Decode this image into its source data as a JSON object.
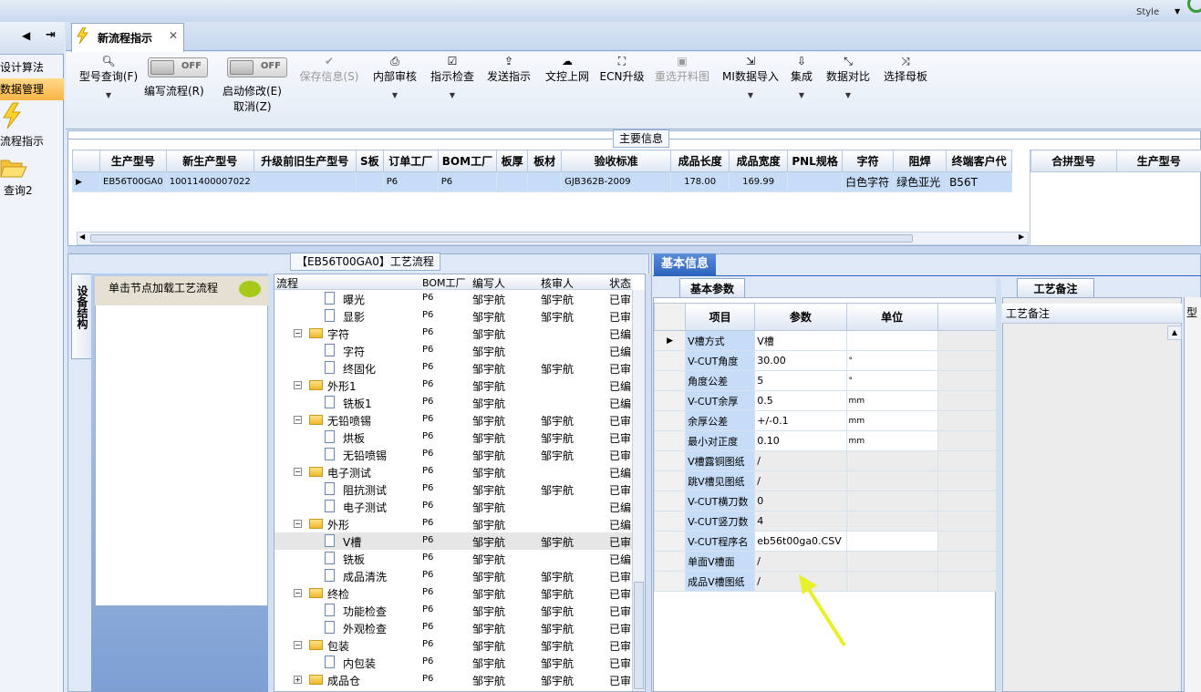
{
  "titlebar": {
    "style_label": "Style"
  },
  "leftnav": {
    "items": [
      "设计算法",
      "数据管理",
      "流程指示",
      "查询2"
    ],
    "selected": 1
  },
  "tab": {
    "label": "新流程指示"
  },
  "toolbar": {
    "model_query": "型号查询(F)",
    "edit_flow": "编写流程(R)",
    "toggle_off": "OFF",
    "start_modify": "启动修改(E)",
    "cancel": "取消(Z)",
    "save_info": "保存信息(S)",
    "internal_review": "内部审核",
    "check_indication": "指示检查",
    "send_indication": "发送指示",
    "doc_upload": "文控上网",
    "ecn_upgrade": "ECN升级",
    "reselect_drawing": "重选开料图",
    "mi_import": "MI数据导入",
    "integrate": "集成",
    "data_compare": "数据对比",
    "select_template": "选择母板"
  },
  "main": {
    "title": "主要信息",
    "columns": [
      "生产型号",
      "新生产型号",
      "升级前旧生产型号",
      "S板",
      "订单工厂",
      "BOM工厂",
      "板厚",
      "板材",
      "验收标准",
      "成品长度",
      "成品宽度",
      "PNL规格",
      "字符",
      "阻焊",
      "终端客户代"
    ],
    "row": [
      "EB56T00GA0",
      "10011400007022",
      "",
      "",
      "P6",
      "P6",
      "",
      "",
      "GJB362B-2009",
      "178.00",
      "169.99",
      "",
      "白色字符",
      "绿色亚光",
      "B56T"
    ],
    "right_columns": [
      "合拼型号",
      "生产型号"
    ]
  },
  "process": {
    "title": "【EB56T00GA0】工艺流程",
    "vtab": "设备结构",
    "hint": "单击节点加载工艺流程",
    "columns": [
      "流程",
      "BOM工厂",
      "编写人",
      "核审人",
      "状态"
    ],
    "rows": [
      {
        "name": "曝光",
        "level": 2,
        "bom": "P6",
        "writer": "邹宇航",
        "reviewer": "邹宇航",
        "status": "已审"
      },
      {
        "name": "显影",
        "level": 2,
        "bom": "P6",
        "writer": "邹宇航",
        "reviewer": "邹宇航",
        "status": "已审"
      },
      {
        "name": "字符",
        "level": 1,
        "bom": "P6",
        "writer": "邹宇航",
        "reviewer": "",
        "status": "已编"
      },
      {
        "name": "字符",
        "level": 2,
        "bom": "P6",
        "writer": "邹宇航",
        "reviewer": "",
        "status": "已编"
      },
      {
        "name": "终固化",
        "level": 2,
        "bom": "P6",
        "writer": "邹宇航",
        "reviewer": "邹宇航",
        "status": "已审"
      },
      {
        "name": "外形1",
        "level": 1,
        "bom": "P6",
        "writer": "邹宇航",
        "reviewer": "",
        "status": "已编"
      },
      {
        "name": "铣板1",
        "level": 2,
        "bom": "P6",
        "writer": "邹宇航",
        "reviewer": "",
        "status": "已编"
      },
      {
        "name": "无铅喷锡",
        "level": 1,
        "bom": "P6",
        "writer": "邹宇航",
        "reviewer": "邹宇航",
        "status": "已审"
      },
      {
        "name": "烘板",
        "level": 2,
        "bom": "P6",
        "writer": "邹宇航",
        "reviewer": "邹宇航",
        "status": "已审"
      },
      {
        "name": "无铅喷锡",
        "level": 2,
        "bom": "P6",
        "writer": "邹宇航",
        "reviewer": "邹宇航",
        "status": "已审"
      },
      {
        "name": "电子测试",
        "level": 1,
        "bom": "P6",
        "writer": "邹宇航",
        "reviewer": "",
        "status": "已编"
      },
      {
        "name": "阻抗测试",
        "level": 2,
        "bom": "P6",
        "writer": "邹宇航",
        "reviewer": "邹宇航",
        "status": "已审"
      },
      {
        "name": "电子测试",
        "level": 2,
        "bom": "P6",
        "writer": "邹宇航",
        "reviewer": "",
        "status": "已编"
      },
      {
        "name": "外形",
        "level": 1,
        "bom": "P6",
        "writer": "邹宇航",
        "reviewer": "",
        "status": "已编"
      },
      {
        "name": "V槽",
        "level": 2,
        "bom": "P6",
        "writer": "邹宇航",
        "reviewer": "邹宇航",
        "status": "已审"
      },
      {
        "name": "铣板",
        "level": 2,
        "bom": "P6",
        "writer": "邹宇航",
        "reviewer": "",
        "status": "已编"
      },
      {
        "name": "成品清洗",
        "level": 2,
        "bom": "P6",
        "writer": "邹宇航",
        "reviewer": "邹宇航",
        "status": "已审"
      },
      {
        "name": "终检",
        "level": 1,
        "bom": "P6",
        "writer": "邹宇航",
        "reviewer": "邹宇航",
        "status": "已审"
      },
      {
        "name": "功能检查",
        "level": 2,
        "bom": "P6",
        "writer": "邹宇航",
        "reviewer": "邹宇航",
        "status": "已审"
      },
      {
        "name": "外观检查",
        "level": 2,
        "bom": "P6",
        "writer": "邹宇航",
        "reviewer": "邹宇航",
        "status": "已审"
      },
      {
        "name": "包装",
        "level": 1,
        "bom": "P6",
        "writer": "邹宇航",
        "reviewer": "邹宇航",
        "status": "已审"
      },
      {
        "name": "内包装",
        "level": 2,
        "bom": "P6",
        "writer": "邹宇航",
        "reviewer": "邹宇航",
        "status": "已审"
      },
      {
        "name": "成品仓",
        "level": 1,
        "bom": "P6",
        "writer": "邹宇航",
        "reviewer": "邹宇航",
        "status": "已审"
      }
    ],
    "selected_index": 14
  },
  "basic": {
    "tab": "基本信息",
    "param_tab": "基本参数",
    "columns": [
      "项目",
      "参数",
      "单位"
    ],
    "rows": [
      [
        "V槽方式",
        "V槽",
        ""
      ],
      [
        "V-CUT角度",
        "30.00",
        "°"
      ],
      [
        "角度公差",
        "5",
        "°"
      ],
      [
        "V-CUT余厚",
        "0.5",
        "mm"
      ],
      [
        "余厚公差",
        "+/-0.1",
        "mm"
      ],
      [
        "最小对正度",
        "0.10",
        "mm"
      ],
      [
        "V槽露铜图纸",
        "/",
        ""
      ],
      [
        "跳V槽见图纸",
        "/",
        ""
      ],
      [
        "V-CUT横刀数",
        "0",
        ""
      ],
      [
        "V-CUT竖刀数",
        "4",
        ""
      ],
      [
        "V-CUT程序名",
        "eb56t00ga0.CSV",
        ""
      ],
      [
        "单面V槽面",
        "/",
        ""
      ],
      [
        "成品V槽图纸",
        "/",
        ""
      ]
    ]
  },
  "remark": {
    "tab": "工艺备注",
    "header": "工艺备注",
    "far_right": "型"
  },
  "colors": {
    "accent": "#2d64bd",
    "selected_row": "#c6dcf7",
    "arrow": "#e8f02c"
  }
}
